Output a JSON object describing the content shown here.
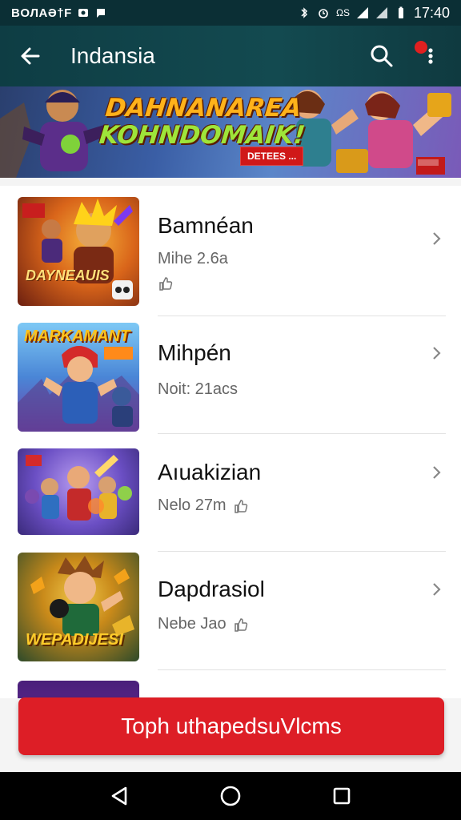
{
  "status_bar": {
    "left_text": "BOЛAƏ†F",
    "right_text": "ΩS",
    "time": "17:40"
  },
  "app_bar": {
    "title": "Indansia",
    "back_icon": "arrow-left-icon",
    "search_icon": "search-icon",
    "menu_icon": "more-vert-icon"
  },
  "banner": {
    "title_line1": "DAHNANAREA",
    "title_line2": "KOHNDOMAIK!",
    "badge": "DETEES ..."
  },
  "items": [
    {
      "title": "Bamnéan",
      "subtitle": "Mihe 2.6a",
      "thumb_text": "DAYNEAUIS",
      "accent": "#d96b1c"
    },
    {
      "title": "Mihpén",
      "subtitle": "Noit: 21acs",
      "thumb_text": "MARKAMANT",
      "accent": "#3b7fd6"
    },
    {
      "title": "Aıuakizian",
      "subtitle": "Nelo 27m",
      "thumb_text": "",
      "accent": "#6b4fc4"
    },
    {
      "title": "Dapdrasiol",
      "subtitle": "Nebe Jao",
      "thumb_text": "WEPADIJESI",
      "accent": "#e2a62a"
    }
  ],
  "cta": {
    "label": "Toph uthapedsuVlcms"
  },
  "nav_bar": {
    "back_icon": "nav-back-icon",
    "home_icon": "nav-home-icon",
    "recents_icon": "nav-recents-icon"
  },
  "colors": {
    "app_bar": "#134a50",
    "cta": "#dd1e26"
  }
}
